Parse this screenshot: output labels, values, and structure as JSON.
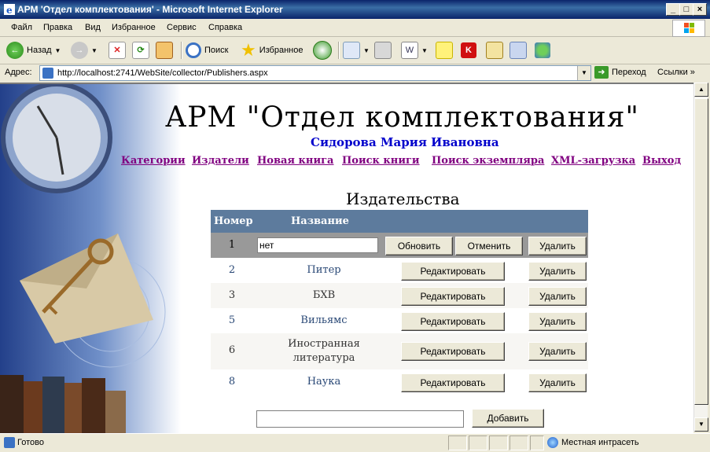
{
  "window": {
    "title": "АРМ 'Отдел комплектования' - Microsoft Internet Explorer"
  },
  "menu": [
    "Файл",
    "Правка",
    "Вид",
    "Избранное",
    "Сервис",
    "Справка"
  ],
  "toolbar": {
    "back": "Назад",
    "search": "Поиск",
    "favorites": "Избранное"
  },
  "address": {
    "label": "Адрес:",
    "url": "http://localhost:2741/WebSite/collector/Publishers.aspx",
    "go": "Переход",
    "links": "Ссылки"
  },
  "page": {
    "heading": "АРМ \"Отдел комплектования\"",
    "user": "Сидорова Мария Ивановна",
    "nav": [
      "Категории",
      "Издатели",
      "Новая книга",
      "Поиск книги",
      "Поиск экземпляра",
      "XML-загрузка",
      "Выход"
    ],
    "title": "Издательства",
    "columns": {
      "number": "Номер",
      "name": "Название"
    },
    "edit_row": {
      "number": "1",
      "value": "нет",
      "update": "Обновить",
      "cancel": "Отменить",
      "delete": "Удалить"
    },
    "rows": [
      {
        "number": "2",
        "name": "Питер"
      },
      {
        "number": "3",
        "name": "БХВ"
      },
      {
        "number": "5",
        "name": "Вильямс"
      },
      {
        "number": "6",
        "name": "Иностранная литература",
        "name_line1": "Иностранная",
        "name_line2": "литература"
      },
      {
        "number": "8",
        "name": "Наука"
      }
    ],
    "edit_label": "Редактировать",
    "delete_label": "Удалить",
    "add_label": "Добавить",
    "add_value": ""
  },
  "status": {
    "text": "Готово",
    "zone": "Местная интрасеть"
  },
  "colors": {
    "grid_header": "#5d7b9d",
    "edit_row": "#999999",
    "alt_row": "#f7f6f3",
    "link_visited": "#800080",
    "user": "#0000cc"
  }
}
